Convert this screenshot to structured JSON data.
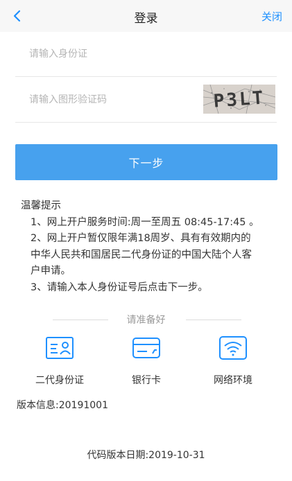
{
  "colors": {
    "accent": "#1e90ff",
    "primary_button": "#47a1ee"
  },
  "nav": {
    "back_icon": "chevron-left-icon",
    "title": "登录",
    "close_label": "关闭"
  },
  "form": {
    "id_placeholder": "请输入身份证",
    "captcha_placeholder": "请输入图形验证码",
    "captcha_text": "P3LT",
    "next_label": "下一步"
  },
  "tips": {
    "heading": "温馨提示",
    "item1": "1、网上开户服务时间:周一至周五 08:45-17:45 。",
    "item2_line1": "2、网上开户暂仅限年满18周岁、具有有效期内的",
    "item2_line2": "中华人民共和国居民二代身份证的中国大陆个人客",
    "item2_line3": "户申请。",
    "item3": "3、请输入本人身份证号后点击下一步。"
  },
  "prepare": {
    "title": "请准备好",
    "items": [
      {
        "icon": "id-card-icon",
        "label": "二代身份证"
      },
      {
        "icon": "bank-card-icon",
        "label": "银行卡"
      },
      {
        "icon": "wifi-icon",
        "label": "网络环境"
      }
    ]
  },
  "footer": {
    "version": "版本信息:20191001",
    "code_date": "代码版本日期:2019-10-31"
  }
}
